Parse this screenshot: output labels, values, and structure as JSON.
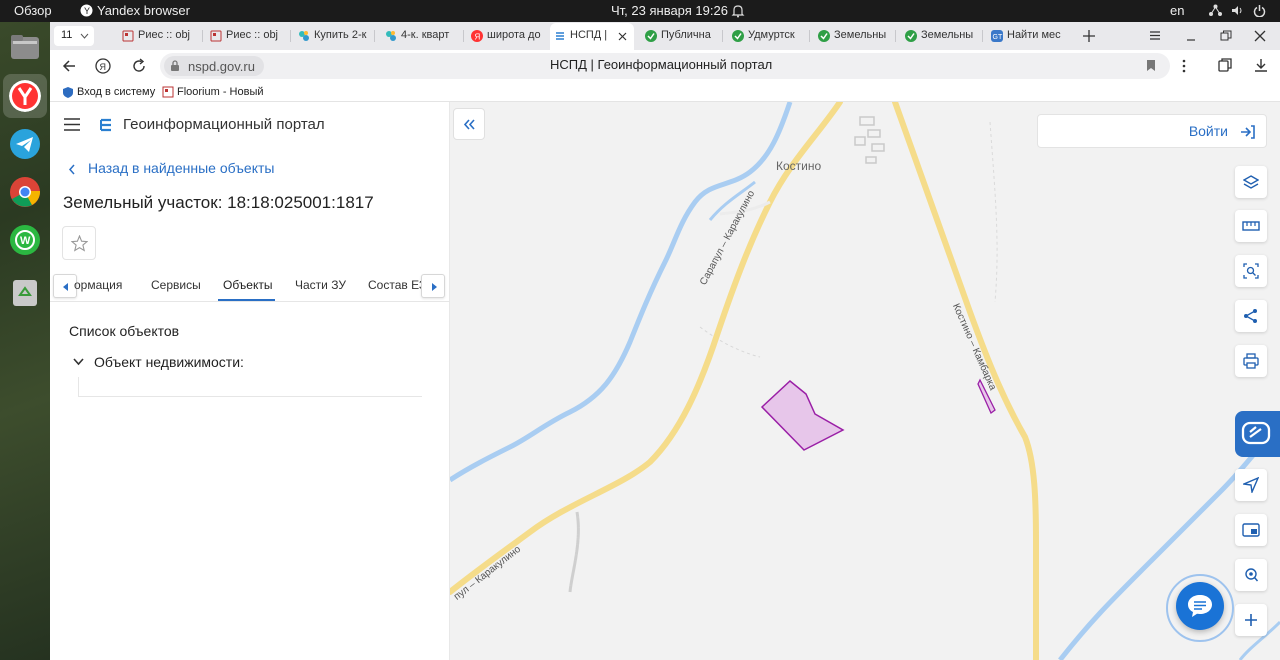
{
  "system": {
    "activities": "Обзор",
    "app_name": "Yandex browser",
    "clock": "Чт, 23 января  19:26",
    "lang": "en"
  },
  "tabs": {
    "counter": "11",
    "items": [
      {
        "label": "Риес :: obj"
      },
      {
        "label": "Риес :: obj"
      },
      {
        "label": "Купить 2-к"
      },
      {
        "label": "4-к. кварт"
      },
      {
        "label": "широта до"
      },
      {
        "label": "НСПД |"
      },
      {
        "label": "Публична"
      },
      {
        "label": "Удмуртск"
      },
      {
        "label": "Земельны"
      },
      {
        "label": "Земельны"
      },
      {
        "label": "Найти мес"
      }
    ]
  },
  "address": {
    "url": "nspd.gov.ru",
    "page_title": "НСПД | Геоинформационный портал"
  },
  "bookmarks": [
    {
      "label": "Вход в систему"
    },
    {
      "label": "Floorium - Новый"
    }
  ],
  "panel": {
    "portal_title": "Геоинформационный портал",
    "back_label": "Назад в найденные объекты",
    "object_title": "Земельный участок: 18:18:025001:1817",
    "tabs": [
      "ормация",
      "Сервисы",
      "Объекты",
      "Части ЗУ",
      "Состав ЕЗ"
    ],
    "active_tab": "Объекты",
    "list_title": "Список объектов",
    "group_label": "Объект недвижимости:"
  },
  "map": {
    "login_label": "Войти",
    "labels": {
      "village": "Костино",
      "road1": "Сарапул – Каракулино",
      "road1b": "пул – Каракулино",
      "road2": "Костино – Камбарка"
    },
    "colors": {
      "road": "#f5dc8a",
      "water": "#a9cdf2",
      "parcel_fill": "#e7c6ea",
      "parcel_stroke": "#9a1fa6",
      "accent": "#2a6fc5"
    }
  }
}
